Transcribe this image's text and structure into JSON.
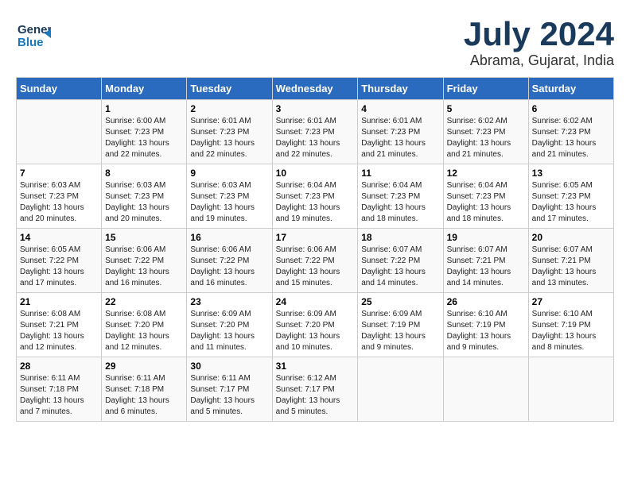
{
  "header": {
    "logo_line1": "General",
    "logo_line2": "Blue",
    "title": "July 2024",
    "subtitle": "Abrama, Gujarat, India"
  },
  "days_of_week": [
    "Sunday",
    "Monday",
    "Tuesday",
    "Wednesday",
    "Thursday",
    "Friday",
    "Saturday"
  ],
  "weeks": [
    [
      {
        "num": "",
        "sunrise": "",
        "sunset": "",
        "daylight": ""
      },
      {
        "num": "1",
        "sunrise": "Sunrise: 6:00 AM",
        "sunset": "Sunset: 7:23 PM",
        "daylight": "Daylight: 13 hours and 22 minutes."
      },
      {
        "num": "2",
        "sunrise": "Sunrise: 6:01 AM",
        "sunset": "Sunset: 7:23 PM",
        "daylight": "Daylight: 13 hours and 22 minutes."
      },
      {
        "num": "3",
        "sunrise": "Sunrise: 6:01 AM",
        "sunset": "Sunset: 7:23 PM",
        "daylight": "Daylight: 13 hours and 22 minutes."
      },
      {
        "num": "4",
        "sunrise": "Sunrise: 6:01 AM",
        "sunset": "Sunset: 7:23 PM",
        "daylight": "Daylight: 13 hours and 21 minutes."
      },
      {
        "num": "5",
        "sunrise": "Sunrise: 6:02 AM",
        "sunset": "Sunset: 7:23 PM",
        "daylight": "Daylight: 13 hours and 21 minutes."
      },
      {
        "num": "6",
        "sunrise": "Sunrise: 6:02 AM",
        "sunset": "Sunset: 7:23 PM",
        "daylight": "Daylight: 13 hours and 21 minutes."
      }
    ],
    [
      {
        "num": "7",
        "sunrise": "Sunrise: 6:03 AM",
        "sunset": "Sunset: 7:23 PM",
        "daylight": "Daylight: 13 hours and 20 minutes."
      },
      {
        "num": "8",
        "sunrise": "Sunrise: 6:03 AM",
        "sunset": "Sunset: 7:23 PM",
        "daylight": "Daylight: 13 hours and 20 minutes."
      },
      {
        "num": "9",
        "sunrise": "Sunrise: 6:03 AM",
        "sunset": "Sunset: 7:23 PM",
        "daylight": "Daylight: 13 hours and 19 minutes."
      },
      {
        "num": "10",
        "sunrise": "Sunrise: 6:04 AM",
        "sunset": "Sunset: 7:23 PM",
        "daylight": "Daylight: 13 hours and 19 minutes."
      },
      {
        "num": "11",
        "sunrise": "Sunrise: 6:04 AM",
        "sunset": "Sunset: 7:23 PM",
        "daylight": "Daylight: 13 hours and 18 minutes."
      },
      {
        "num": "12",
        "sunrise": "Sunrise: 6:04 AM",
        "sunset": "Sunset: 7:23 PM",
        "daylight": "Daylight: 13 hours and 18 minutes."
      },
      {
        "num": "13",
        "sunrise": "Sunrise: 6:05 AM",
        "sunset": "Sunset: 7:23 PM",
        "daylight": "Daylight: 13 hours and 17 minutes."
      }
    ],
    [
      {
        "num": "14",
        "sunrise": "Sunrise: 6:05 AM",
        "sunset": "Sunset: 7:22 PM",
        "daylight": "Daylight: 13 hours and 17 minutes."
      },
      {
        "num": "15",
        "sunrise": "Sunrise: 6:06 AM",
        "sunset": "Sunset: 7:22 PM",
        "daylight": "Daylight: 13 hours and 16 minutes."
      },
      {
        "num": "16",
        "sunrise": "Sunrise: 6:06 AM",
        "sunset": "Sunset: 7:22 PM",
        "daylight": "Daylight: 13 hours and 16 minutes."
      },
      {
        "num": "17",
        "sunrise": "Sunrise: 6:06 AM",
        "sunset": "Sunset: 7:22 PM",
        "daylight": "Daylight: 13 hours and 15 minutes."
      },
      {
        "num": "18",
        "sunrise": "Sunrise: 6:07 AM",
        "sunset": "Sunset: 7:22 PM",
        "daylight": "Daylight: 13 hours and 14 minutes."
      },
      {
        "num": "19",
        "sunrise": "Sunrise: 6:07 AM",
        "sunset": "Sunset: 7:21 PM",
        "daylight": "Daylight: 13 hours and 14 minutes."
      },
      {
        "num": "20",
        "sunrise": "Sunrise: 6:07 AM",
        "sunset": "Sunset: 7:21 PM",
        "daylight": "Daylight: 13 hours and 13 minutes."
      }
    ],
    [
      {
        "num": "21",
        "sunrise": "Sunrise: 6:08 AM",
        "sunset": "Sunset: 7:21 PM",
        "daylight": "Daylight: 13 hours and 12 minutes."
      },
      {
        "num": "22",
        "sunrise": "Sunrise: 6:08 AM",
        "sunset": "Sunset: 7:20 PM",
        "daylight": "Daylight: 13 hours and 12 minutes."
      },
      {
        "num": "23",
        "sunrise": "Sunrise: 6:09 AM",
        "sunset": "Sunset: 7:20 PM",
        "daylight": "Daylight: 13 hours and 11 minutes."
      },
      {
        "num": "24",
        "sunrise": "Sunrise: 6:09 AM",
        "sunset": "Sunset: 7:20 PM",
        "daylight": "Daylight: 13 hours and 10 minutes."
      },
      {
        "num": "25",
        "sunrise": "Sunrise: 6:09 AM",
        "sunset": "Sunset: 7:19 PM",
        "daylight": "Daylight: 13 hours and 9 minutes."
      },
      {
        "num": "26",
        "sunrise": "Sunrise: 6:10 AM",
        "sunset": "Sunset: 7:19 PM",
        "daylight": "Daylight: 13 hours and 9 minutes."
      },
      {
        "num": "27",
        "sunrise": "Sunrise: 6:10 AM",
        "sunset": "Sunset: 7:19 PM",
        "daylight": "Daylight: 13 hours and 8 minutes."
      }
    ],
    [
      {
        "num": "28",
        "sunrise": "Sunrise: 6:11 AM",
        "sunset": "Sunset: 7:18 PM",
        "daylight": "Daylight: 13 hours and 7 minutes."
      },
      {
        "num": "29",
        "sunrise": "Sunrise: 6:11 AM",
        "sunset": "Sunset: 7:18 PM",
        "daylight": "Daylight: 13 hours and 6 minutes."
      },
      {
        "num": "30",
        "sunrise": "Sunrise: 6:11 AM",
        "sunset": "Sunset: 7:17 PM",
        "daylight": "Daylight: 13 hours and 5 minutes."
      },
      {
        "num": "31",
        "sunrise": "Sunrise: 6:12 AM",
        "sunset": "Sunset: 7:17 PM",
        "daylight": "Daylight: 13 hours and 5 minutes."
      },
      {
        "num": "",
        "sunrise": "",
        "sunset": "",
        "daylight": ""
      },
      {
        "num": "",
        "sunrise": "",
        "sunset": "",
        "daylight": ""
      },
      {
        "num": "",
        "sunrise": "",
        "sunset": "",
        "daylight": ""
      }
    ]
  ]
}
